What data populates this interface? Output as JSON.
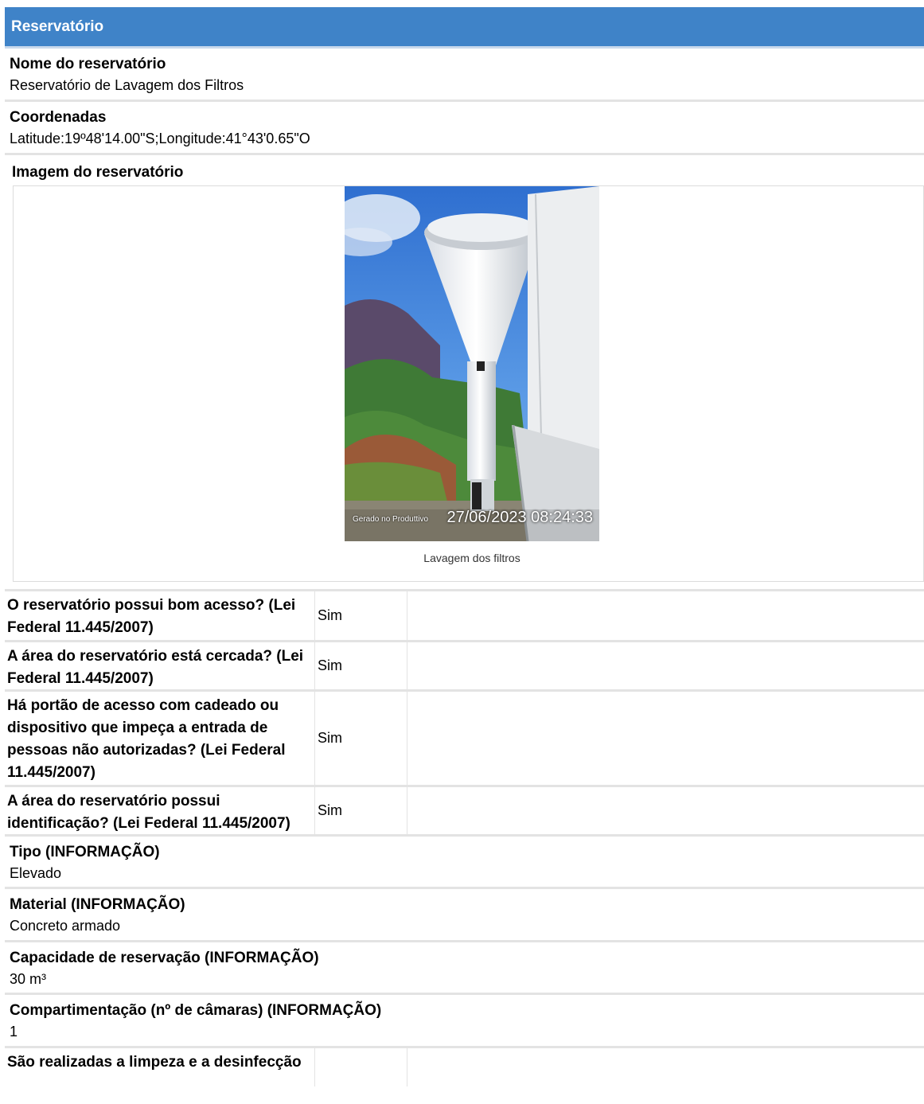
{
  "section": {
    "title": "Reservatório"
  },
  "fields": [
    {
      "label": "Nome do reservatório",
      "value": "Reservatório de Lavagem dos Filtros"
    },
    {
      "label": "Coordenadas",
      "value": "Latitude:19º48'14.00\"S;Longitude:41°43'0.65\"O"
    }
  ],
  "image": {
    "label": "Imagem do reservatório",
    "caption": "Lavagem dos filtros",
    "stamp_text": "27/06/2023 08:24:33",
    "stamp_small": "Gerado no Produttivo"
  },
  "questions": [
    {
      "question": "O reservatório possui bom acesso? (Lei Federal 11.445/2007)",
      "answer": "Sim"
    },
    {
      "question": "A área do reservatório está cercada? (Lei Federal 11.445/2007)",
      "answer": "Sim"
    },
    {
      "question": "Há portão de acesso com cadeado ou dispositivo que impeça a entrada de pessoas não autorizadas? (Lei Federal 11.445/2007)",
      "answer": "Sim"
    },
    {
      "question": "A área do reservatório possui identificação? (Lei Federal 11.445/2007)",
      "answer": "Sim"
    }
  ],
  "info_fields": [
    {
      "label": "Tipo (INFORMAÇÃO)",
      "value": "Elevado"
    },
    {
      "label": "Material (INFORMAÇÃO)",
      "value": "Concreto armado"
    },
    {
      "label": "Capacidade de reservação (INFORMAÇÃO)",
      "value": "30 m³"
    },
    {
      "label": "Compartimentação (nº de câmaras) (INFORMAÇÃO)",
      "value": "1"
    }
  ],
  "last_question": {
    "question": "São realizadas a limpeza e a desinfecção"
  },
  "colors": {
    "header_bg": "#3f83c8",
    "header_text": "#ffffff",
    "divider": "#e3e3e3"
  }
}
